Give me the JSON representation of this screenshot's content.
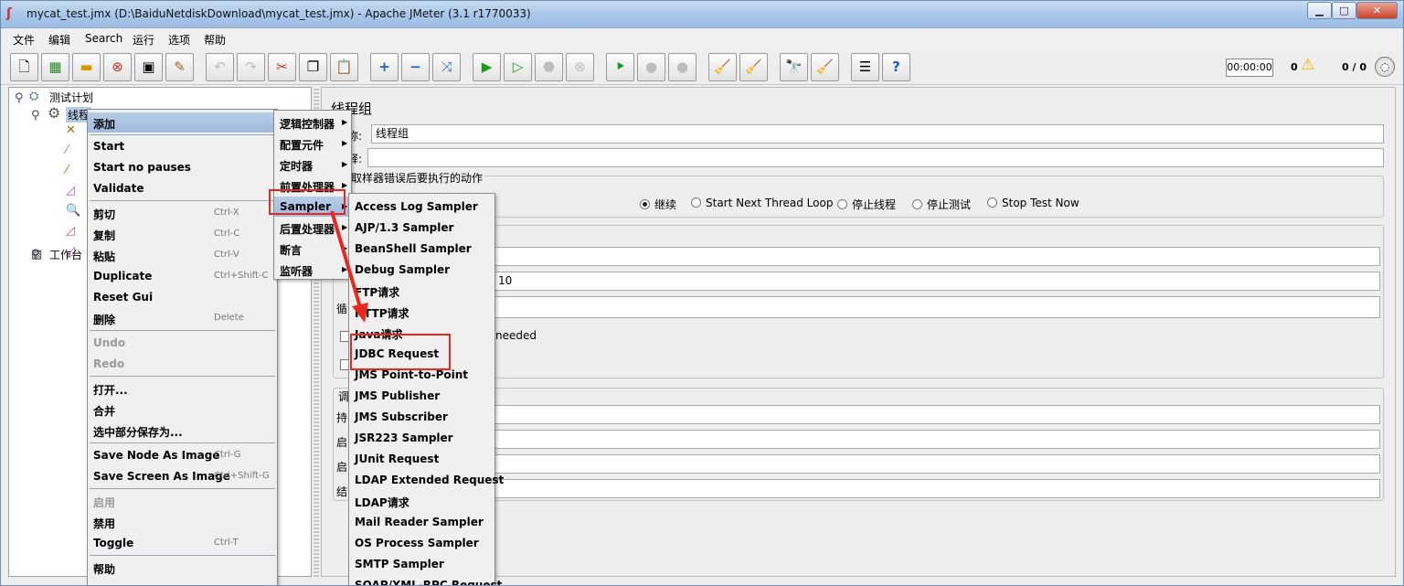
{
  "window": {
    "title": "mycat_test.jmx (D:\\BaiduNetdiskDownload\\mycat_test.jmx) - Apache JMeter (3.1 r1770033)",
    "minimize": "▁",
    "maximize": "□",
    "close": "✕"
  },
  "menubar": [
    "文件",
    "编辑",
    "Search",
    "运行",
    "选项",
    "帮助"
  ],
  "toolbar": {
    "timer": "00:00:00",
    "warnings": "0",
    "threads": "0 / 0",
    "icons": [
      "new-icon",
      "templates-icon",
      "open-icon",
      "close-icon",
      "save-icon",
      "save-as-icon",
      "undo-icon",
      "redo-icon",
      "cut-icon",
      "copy-icon",
      "paste-icon",
      "expand-icon",
      "collapse-icon",
      "toggle-icon",
      "start-icon",
      "start-no-pause-icon",
      "stop-icon",
      "shutdown-icon",
      "remote-start-icon",
      "remote-stop-icon",
      "remote-shutdown-icon",
      "clear-icon",
      "clear-all-icon",
      "search-icon",
      "reset-search-icon",
      "function-helper-icon",
      "help-icon"
    ]
  },
  "tree": {
    "test_plan": "测试计划",
    "thread_group": "线程",
    "workbench": "工作台"
  },
  "right_panel": {
    "title": "线程组",
    "name_label": "称:",
    "name_value": "线程组",
    "comment_label": "释:",
    "error_group_label": "取样器错误后要执行的动作",
    "radios": [
      "继续",
      "Start Next Thread Loop",
      "停止线程",
      "停止测试",
      "Stop Test Now"
    ],
    "ramp_value": "10",
    "loop_label": "循",
    "needed_text": "needed",
    "sched_label": "调",
    "field_labels": [
      "持",
      "启",
      "启",
      "结"
    ]
  },
  "context_menu": {
    "items": [
      {
        "label": "添加",
        "shortcut": "",
        "disabled": false
      },
      {
        "label": "Start",
        "shortcut": "",
        "disabled": false
      },
      {
        "label": "Start no pauses",
        "shortcut": "",
        "disabled": false
      },
      {
        "label": "Validate",
        "shortcut": "",
        "disabled": false
      },
      {
        "label": "剪切",
        "shortcut": "Ctrl-X",
        "disabled": false
      },
      {
        "label": "复制",
        "shortcut": "Ctrl-C",
        "disabled": false
      },
      {
        "label": "粘贴",
        "shortcut": "Ctrl-V",
        "disabled": false
      },
      {
        "label": "Duplicate",
        "shortcut": "Ctrl+Shift-C",
        "disabled": false
      },
      {
        "label": "Reset Gui",
        "shortcut": "",
        "disabled": false
      },
      {
        "label": "删除",
        "shortcut": "Delete",
        "disabled": false
      },
      {
        "label": "Undo",
        "shortcut": "",
        "disabled": true
      },
      {
        "label": "Redo",
        "shortcut": "",
        "disabled": true
      },
      {
        "label": "打开...",
        "shortcut": "",
        "disabled": false
      },
      {
        "label": "合并",
        "shortcut": "",
        "disabled": false
      },
      {
        "label": "选中部分保存为...",
        "shortcut": "",
        "disabled": false
      },
      {
        "label": "Save Node As Image",
        "shortcut": "Ctrl-G",
        "disabled": false
      },
      {
        "label": "Save Screen As Image",
        "shortcut": "Ctrl+Shift-G",
        "disabled": false
      },
      {
        "label": "启用",
        "shortcut": "",
        "disabled": true
      },
      {
        "label": "禁用",
        "shortcut": "",
        "disabled": false
      },
      {
        "label": "Toggle",
        "shortcut": "Ctrl-T",
        "disabled": false
      },
      {
        "label": "帮助",
        "shortcut": "",
        "disabled": false
      }
    ]
  },
  "add_submenu": {
    "items": [
      "逻辑控制器",
      "配置元件",
      "定时器",
      "前置处理器",
      "Sampler",
      "后置处理器",
      "断言",
      "监听器"
    ]
  },
  "sampler_submenu": {
    "items": [
      "Access Log Sampler",
      "AJP/1.3 Sampler",
      "BeanShell Sampler",
      "Debug Sampler",
      "FTP请求",
      "HTTP请求",
      "Java请求",
      "JDBC Request",
      "JMS Point-to-Point",
      "JMS Publisher",
      "JMS Subscriber",
      "JSR223 Sampler",
      "JUnit Request",
      "LDAP Extended Request",
      "LDAP请求",
      "Mail Reader Sampler",
      "OS Process Sampler",
      "SMTP Sampler",
      "SOAP/XML-RPC Request"
    ]
  },
  "annotation_color": "#e8281e"
}
